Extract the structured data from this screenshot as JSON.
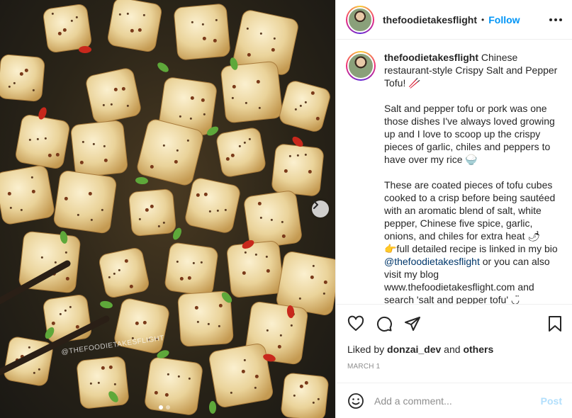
{
  "post": {
    "image_watermark": "@THEFOODIETAKESFLIGHT",
    "carousel_dots": 2
  },
  "header": {
    "username": "thefoodietakesflight",
    "bullet": "•",
    "follow_label": "Follow"
  },
  "caption": {
    "username": "thefoodietakesflight",
    "intro": " Chinese restaurant-style Crispy Salt and Pepper Tofu! 🥢\n\nSalt and pepper tofu or pork was one those dishes I've always loved growing up and I love to scoop up the crispy pieces of garlic, chiles and peppers to have over my rice 🍚\n\nThese are coated pieces of tofu cubes cooked to a crisp before being sautéed with an aromatic blend of salt, white pepper, Chinese five spice, garlic, onions, and chiles for extra heat 🌶\n👉full detailed recipe is linked in my bio ",
    "mention": "@thefoodietakesflight",
    "outro": " or you can also visit my blog www.thefoodietakesflight.com and search 'salt and pepper tofu' ◡̈"
  },
  "likes": {
    "prefix": "Liked by ",
    "user": "donzai_dev",
    "middle": " and ",
    "others": "others"
  },
  "date": "MARCH 1",
  "comment": {
    "placeholder": "Add a comment...",
    "post_label": "Post"
  },
  "icons": {
    "heart": "heart-icon",
    "comment": "comment-icon",
    "share": "paper-plane-icon",
    "save": "bookmark-icon",
    "emoji": "smiley-icon",
    "more": "more-horizontal-icon",
    "next": "chevron-right-icon"
  },
  "colors": {
    "accent": "#0095f6",
    "post_disabled": "#b2dffc",
    "text": "#262626",
    "muted": "#8e8e8e"
  }
}
